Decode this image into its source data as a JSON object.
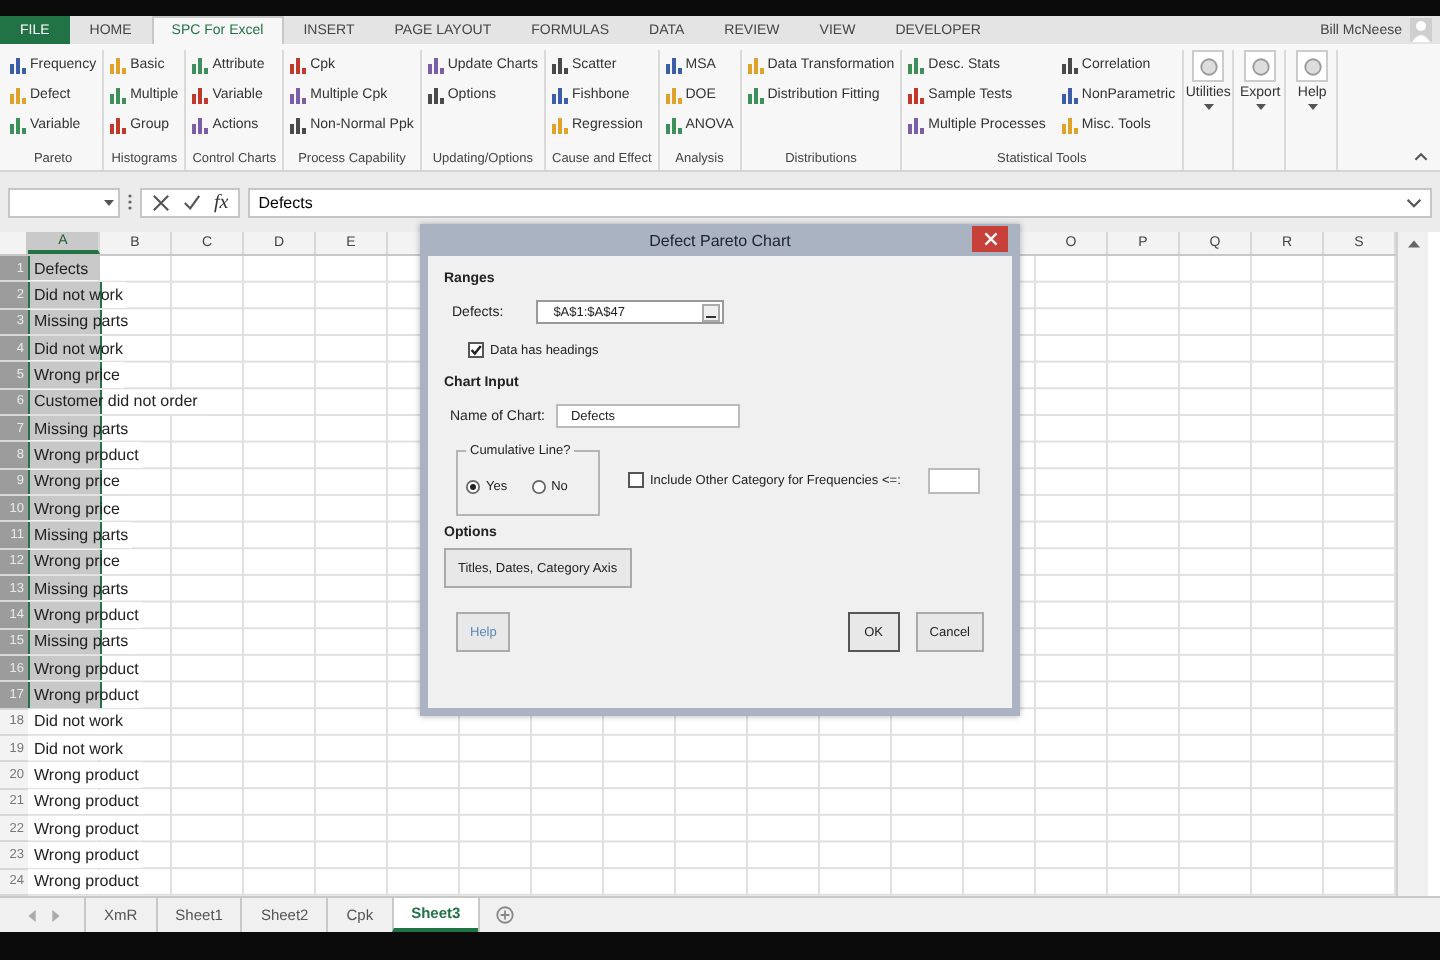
{
  "ribbon_tabs": [
    {
      "label": "FILE",
      "kind": "file",
      "selected": false
    },
    {
      "label": "HOME",
      "kind": "tab",
      "selected": false
    },
    {
      "label": "SPC For Excel",
      "kind": "tab",
      "selected": true
    },
    {
      "label": "INSERT",
      "kind": "tab",
      "selected": false
    },
    {
      "label": "PAGE LAYOUT",
      "kind": "tab",
      "selected": false
    },
    {
      "label": "FORMULAS",
      "kind": "tab",
      "selected": false
    },
    {
      "label": "DATA",
      "kind": "tab",
      "selected": false
    },
    {
      "label": "REVIEW",
      "kind": "tab",
      "selected": false
    },
    {
      "label": "VIEW",
      "kind": "tab",
      "selected": false
    },
    {
      "label": "DEVELOPER",
      "kind": "tab",
      "selected": false
    }
  ],
  "user": {
    "name": "Bill McNeese"
  },
  "ribbon_groups": [
    {
      "label": "Pareto",
      "items": [
        "Frequency",
        "Defect",
        "Variable"
      ]
    },
    {
      "label": "Histograms",
      "items": [
        "Basic",
        "Multiple",
        "Group"
      ]
    },
    {
      "label": "Control Charts",
      "items": [
        "Attribute",
        "Variable",
        "Actions"
      ]
    },
    {
      "label": "Process Capability",
      "items": [
        "Cpk",
        "Multiple Cpk",
        "Non-Normal Ppk"
      ]
    },
    {
      "label": "Updating/Options",
      "items": [
        "Update Charts",
        "Options"
      ]
    },
    {
      "label": "Cause and Effect",
      "items": [
        "Scatter",
        "Fishbone",
        "Regression"
      ]
    },
    {
      "label": "Analysis",
      "items": [
        "MSA",
        "DOE",
        "ANOVA"
      ]
    },
    {
      "label": "Distributions",
      "items": [
        "Data Transformation",
        "Distribution Fitting"
      ]
    },
    {
      "label": "Statistical Tools",
      "items": [
        "Desc. Stats",
        "Sample Tests",
        "Multiple Processes",
        "Correlation",
        "NonParametric",
        "Misc. Tools"
      ]
    }
  ],
  "big_buttons": [
    {
      "label": "Utilities"
    },
    {
      "label": "Export"
    },
    {
      "label": "Help"
    }
  ],
  "formula_bar": {
    "function_label": "fx",
    "value": "Defects"
  },
  "column_headers": {
    "left": [
      {
        "label": "A",
        "selected": true
      },
      {
        "label": "B",
        "selected": false
      },
      {
        "label": "C",
        "selected": false
      },
      {
        "label": "D",
        "selected": false
      },
      {
        "label": "E",
        "selected": false
      }
    ],
    "right": [
      {
        "label": "O",
        "selected": false
      },
      {
        "label": "P",
        "selected": false
      },
      {
        "label": "Q",
        "selected": false
      },
      {
        "label": "R",
        "selected": false
      },
      {
        "label": "S",
        "selected": false
      }
    ]
  },
  "rows": [
    {
      "number": "1",
      "text": "Defects",
      "selected": true
    },
    {
      "number": "2",
      "text": "Did not work",
      "selected": true
    },
    {
      "number": "3",
      "text": "Missing parts",
      "selected": true
    },
    {
      "number": "4",
      "text": "Did not work",
      "selected": true
    },
    {
      "number": "5",
      "text": "Wrong price",
      "selected": true
    },
    {
      "number": "6",
      "text": "Customer did not order",
      "selected": true
    },
    {
      "number": "7",
      "text": "Missing parts",
      "selected": true
    },
    {
      "number": "8",
      "text": "Wrong product",
      "selected": true
    },
    {
      "number": "9",
      "text": "Wrong price",
      "selected": true
    },
    {
      "number": "10",
      "text": "Wrong price",
      "selected": true
    },
    {
      "number": "11",
      "text": "Missing parts",
      "selected": true
    },
    {
      "number": "12",
      "text": "Wrong price",
      "selected": true
    },
    {
      "number": "13",
      "text": "Missing parts",
      "selected": true
    },
    {
      "number": "14",
      "text": "Wrong product",
      "selected": true
    },
    {
      "number": "15",
      "text": "Missing parts",
      "selected": true
    },
    {
      "number": "16",
      "text": "Wrong product",
      "selected": true
    },
    {
      "number": "17",
      "text": "Wrong product",
      "selected": true
    },
    {
      "number": "18",
      "text": "Did not work",
      "selected": false
    },
    {
      "number": "19",
      "text": "Did not work",
      "selected": false
    },
    {
      "number": "20",
      "text": "Wrong product",
      "selected": false
    },
    {
      "number": "21",
      "text": "Wrong product",
      "selected": false
    },
    {
      "number": "22",
      "text": "Wrong product",
      "selected": false
    },
    {
      "number": "23",
      "text": "Wrong product",
      "selected": false
    },
    {
      "number": "24",
      "text": "Wrong product",
      "selected": false
    }
  ],
  "sheet_tabs": [
    {
      "label": "XmR",
      "selected": false
    },
    {
      "label": "Sheet1",
      "selected": false
    },
    {
      "label": "Sheet2",
      "selected": false
    },
    {
      "label": "Cpk",
      "selected": false
    },
    {
      "label": "Sheet3",
      "selected": true
    }
  ],
  "dialog": {
    "title": "Defect Pareto Chart",
    "ranges_heading": "Ranges",
    "defects_label": "Defects:",
    "defects_value": "$A$1:$A$47",
    "headings_checkbox": {
      "label": "Data has headings",
      "checked": true
    },
    "chart_input_heading": "Chart Input",
    "name_label": "Name of Chart:",
    "name_value": "Defects",
    "cumulative_group": {
      "label": "Cumulative Line?",
      "options": [
        {
          "label": "Yes",
          "selected": true
        },
        {
          "label": "No",
          "selected": false
        }
      ]
    },
    "other_checkbox": {
      "label": "Include Other Category for Frequencies <=:",
      "checked": false
    },
    "options_heading": "Options",
    "titles_button": "Titles, Dates, Category Axis",
    "buttons": [
      {
        "label": "Help",
        "kind": "help"
      },
      {
        "label": "OK",
        "kind": "ok"
      },
      {
        "label": "Cancel",
        "kind": "cancel"
      }
    ]
  }
}
